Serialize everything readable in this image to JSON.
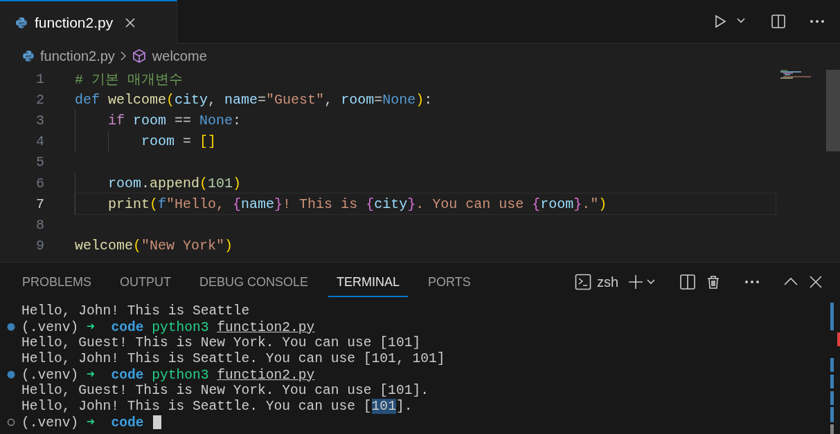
{
  "tabs": [
    {
      "label": "function2.py",
      "selected": true
    }
  ],
  "breadcrumb": {
    "file": "function2.py",
    "symbol": "welcome"
  },
  "code_lines": [
    {
      "number": "1",
      "current": false,
      "tokens": [
        {
          "kind": "comment",
          "text": "# 기본 매개변수"
        }
      ]
    },
    {
      "number": "2",
      "current": false,
      "tokens": [
        {
          "kind": "kw",
          "text": "def "
        },
        {
          "kind": "fn",
          "text": "welcome"
        },
        {
          "kind": "bracket",
          "text": "("
        },
        {
          "kind": "var",
          "text": "city"
        },
        {
          "kind": "punct",
          "text": ", "
        },
        {
          "kind": "var",
          "text": "name"
        },
        {
          "kind": "punct",
          "text": "="
        },
        {
          "kind": "str",
          "text": "\"Guest\""
        },
        {
          "kind": "punct",
          "text": ", "
        },
        {
          "kind": "var",
          "text": "room"
        },
        {
          "kind": "punct",
          "text": "="
        },
        {
          "kind": "kw",
          "text": "None"
        },
        {
          "kind": "bracket",
          "text": ")"
        },
        {
          "kind": "punct",
          "text": ":"
        }
      ]
    },
    {
      "number": "3",
      "current": false,
      "tokens": [
        {
          "kind": "ctrl",
          "text": "    if "
        },
        {
          "kind": "var",
          "text": "room"
        },
        {
          "kind": "punct",
          "text": " == "
        },
        {
          "kind": "kw",
          "text": "None"
        },
        {
          "kind": "punct",
          "text": ":"
        }
      ]
    },
    {
      "number": "4",
      "current": false,
      "tokens": [
        {
          "kind": "var",
          "text": "        room"
        },
        {
          "kind": "punct",
          "text": " = "
        },
        {
          "kind": "bracket",
          "text": "[]"
        }
      ]
    },
    {
      "number": "5",
      "current": false
    },
    {
      "number": "6",
      "current": false,
      "tokens": [
        {
          "kind": "var",
          "text": "    room"
        },
        {
          "kind": "punct",
          "text": "."
        },
        {
          "kind": "fn",
          "text": "append"
        },
        {
          "kind": "bracket",
          "text": "("
        },
        {
          "kind": "num",
          "text": "101"
        },
        {
          "kind": "bracket",
          "text": ")"
        }
      ]
    },
    {
      "number": "7",
      "current": true,
      "tokens": [
        {
          "kind": "fn",
          "text": "    print"
        },
        {
          "kind": "bracket",
          "text": "("
        },
        {
          "kind": "kw",
          "text": "f"
        },
        {
          "kind": "str",
          "text": "\"Hello, "
        },
        {
          "kind": "brace",
          "text": "{"
        },
        {
          "kind": "var",
          "text": "name"
        },
        {
          "kind": "brace",
          "text": "}"
        },
        {
          "kind": "str",
          "text": "! This is "
        },
        {
          "kind": "brace",
          "text": "{"
        },
        {
          "kind": "var",
          "text": "city"
        },
        {
          "kind": "brace",
          "text": "}"
        },
        {
          "kind": "str",
          "text": ". You can use "
        },
        {
          "kind": "brace",
          "text": "{"
        },
        {
          "kind": "var",
          "text": "room"
        },
        {
          "kind": "brace",
          "text": "}"
        },
        {
          "kind": "str",
          "text": ".\""
        },
        {
          "kind": "bracket",
          "text": ")"
        }
      ]
    },
    {
      "number": "8",
      "current": false
    },
    {
      "number": "9",
      "current": false,
      "tokens": [
        {
          "kind": "fn",
          "text": "welcome"
        },
        {
          "kind": "bracket",
          "text": "("
        },
        {
          "kind": "str",
          "text": "\"New York\""
        },
        {
          "kind": "bracket",
          "text": ")"
        }
      ]
    }
  ],
  "panel_tabs": [
    {
      "label": "PROBLEMS",
      "selected": false
    },
    {
      "label": "OUTPUT",
      "selected": false
    },
    {
      "label": "DEBUG CONSOLE",
      "selected": false
    },
    {
      "label": "TERMINAL",
      "selected": true
    },
    {
      "label": "PORTS",
      "selected": false
    }
  ],
  "terminal_name": "zsh",
  "terminal_lines": [
    {
      "kind": "output",
      "segments": [
        {
          "kind": "plain",
          "text": "Hello, John! This is Seattle"
        }
      ]
    },
    {
      "kind": "prompt",
      "finished": true,
      "segments": [
        {
          "kind": "plain",
          "text": "(.venv) "
        },
        {
          "kind": "arrow",
          "text": "➜  "
        },
        {
          "kind": "cmd",
          "text": "code "
        },
        {
          "kind": "prog",
          "text": "python3 "
        },
        {
          "kind": "file",
          "text": "function2.py"
        }
      ]
    },
    {
      "kind": "output",
      "segments": [
        {
          "kind": "plain",
          "text": "Hello, Guest! This is New York. You can use [101]"
        }
      ]
    },
    {
      "kind": "output",
      "segments": [
        {
          "kind": "plain",
          "text": "Hello, John! This is Seattle. You can use [101, 101]"
        }
      ]
    },
    {
      "kind": "prompt",
      "finished": true,
      "segments": [
        {
          "kind": "plain",
          "text": "(.venv) "
        },
        {
          "kind": "arrow",
          "text": "➜  "
        },
        {
          "kind": "cmd",
          "text": "code "
        },
        {
          "kind": "prog",
          "text": "python3 "
        },
        {
          "kind": "file",
          "text": "function2.py"
        }
      ]
    },
    {
      "kind": "output",
      "segments": [
        {
          "kind": "plain",
          "text": "Hello, Guest! This is New York. You can use [101]."
        }
      ]
    },
    {
      "kind": "output",
      "segments": [
        {
          "kind": "plain",
          "text": "Hello, John! This is Seattle. You can use ["
        },
        {
          "kind": "selected",
          "text": "101"
        },
        {
          "kind": "plain",
          "text": "]."
        }
      ]
    },
    {
      "kind": "prompt",
      "finished": false,
      "cursor": true,
      "segments": [
        {
          "kind": "plain",
          "text": "(.venv) "
        },
        {
          "kind": "arrow",
          "text": "➜  "
        },
        {
          "kind": "cmd",
          "text": "code "
        }
      ]
    }
  ]
}
